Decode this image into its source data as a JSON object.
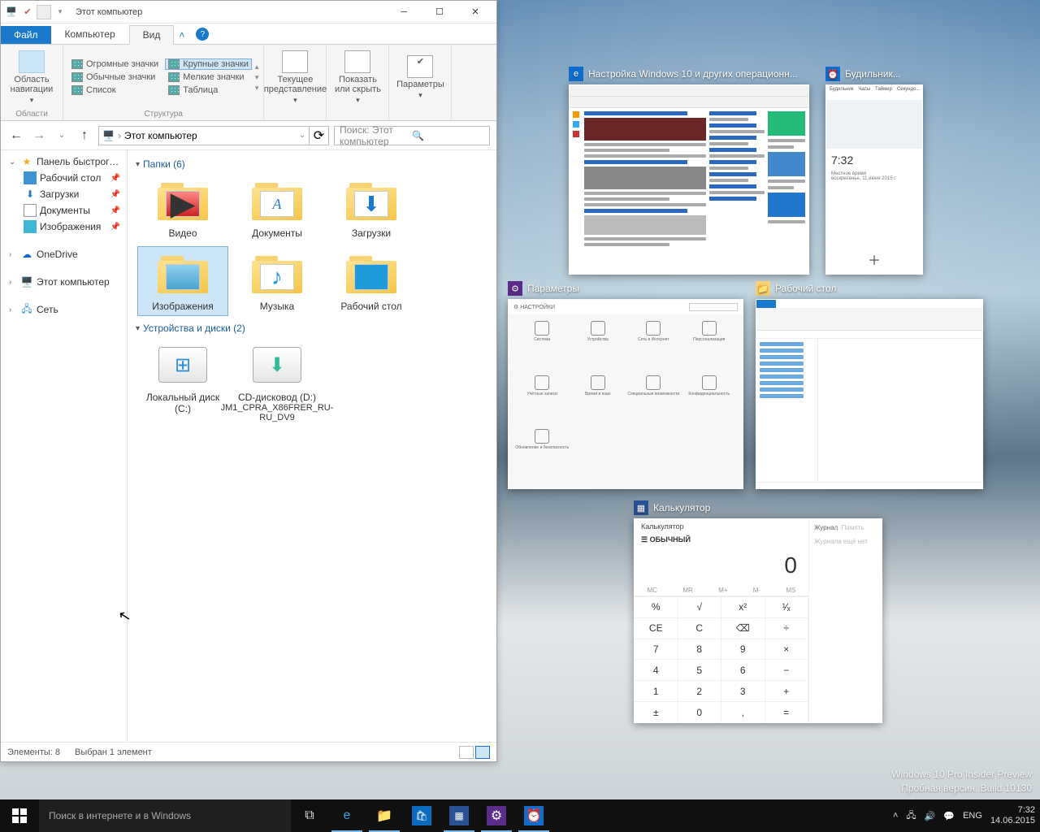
{
  "explorer": {
    "title": "Этот компьютер",
    "tabs": {
      "file": "Файл",
      "computer": "Компьютер",
      "view": "Вид"
    },
    "ribbon": {
      "nav_pane": "Область навигации",
      "nav_group": "Области",
      "extra_large": "Огромные значки",
      "large": "Крупные значки",
      "medium": "Обычные значки",
      "small": "Мелкие значки",
      "list": "Список",
      "table": "Таблица",
      "layout_group": "Структура",
      "current_view": "Текущее представление",
      "show_hide": "Показать или скрыть",
      "options": "Параметры"
    },
    "path": "Этот компьютер",
    "search_ph": "Поиск: Этот компьютер",
    "tree": {
      "quick": "Панель быстрого доступа",
      "desktop": "Рабочий стол",
      "downloads": "Загрузки",
      "documents": "Документы",
      "pictures": "Изображения",
      "onedrive": "OneDrive",
      "this_pc": "Этот компьютер",
      "network": "Сеть"
    },
    "sections": {
      "folders": "Папки (6)",
      "devices": "Устройства и диски (2)"
    },
    "folders": {
      "video": "Видео",
      "documents": "Документы",
      "downloads": "Загрузки",
      "pictures": "Изображения",
      "music": "Музыка",
      "desktop": "Рабочий стол"
    },
    "drives": {
      "c": "Локальный диск (C:)",
      "d": {
        "l1": "CD-дисковод (D:)",
        "l2": "JM1_CPRA_X86FRER_RU-RU_DV9"
      }
    },
    "status": {
      "items": "Элементы: 8",
      "selected": "Выбран 1 элемент"
    }
  },
  "taskview": {
    "w1": "Настройка Windows 10 и других операционн...",
    "w2": "Будильник...",
    "w3": "Параметры",
    "w4": "Рабочий стол",
    "w5": "Калькулятор"
  },
  "alarm": {
    "time": "7:32",
    "tz": "Местное время",
    "date": "воскресенье, 11 июня 2015 г."
  },
  "settings": {
    "header": "НАСТРОЙКИ",
    "items": [
      "Система",
      "Устройства",
      "Сеть и Интернет",
      "Персонализация",
      "Учётные записи",
      "Время и язык",
      "Специальные возможности",
      "Конфиденциальность",
      "Обновление и безопасность"
    ]
  },
  "calc": {
    "title": "Калькулятор",
    "mode": "☰  ОБЫЧНЫЙ",
    "display": "0",
    "hist": "Журнал",
    "mem": "Память",
    "empty": "Журнала ещё нет",
    "mem_row": [
      "MC",
      "MR",
      "M+",
      "M-",
      "MS"
    ],
    "keys": [
      "%",
      "√",
      "x²",
      "¹⁄ₓ",
      "CE",
      "C",
      "⌫",
      "÷",
      "7",
      "8",
      "9",
      "×",
      "4",
      "5",
      "6",
      "−",
      "1",
      "2",
      "3",
      "+",
      "±",
      "0",
      ",",
      "="
    ]
  },
  "watermark": {
    "l1": "Windows 10 Pro Insider Preview",
    "l2": "Пробная версия. Build 10130"
  },
  "taskbar": {
    "search": "Поиск в интернете и в Windows",
    "lang": "ENG",
    "time": "7:32",
    "date": "14.06.2015"
  }
}
